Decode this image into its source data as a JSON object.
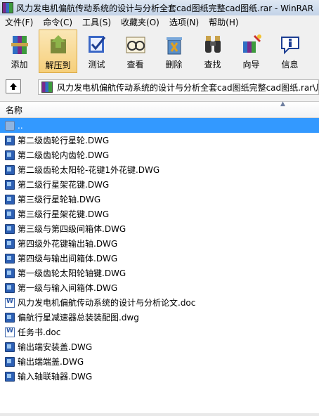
{
  "window": {
    "title": "风力发电机偏航传动系统的设计与分析全套cad图纸完整cad图纸.rar - WinRAR"
  },
  "menu": [
    "文件(F)",
    "命令(C)",
    "工具(S)",
    "收藏夹(O)",
    "选项(N)",
    "帮助(H)"
  ],
  "toolbar": [
    {
      "label": "添加",
      "icon": "add-icon"
    },
    {
      "label": "解压到",
      "icon": "extract-icon",
      "active": true
    },
    {
      "label": "测试",
      "icon": "test-icon"
    },
    {
      "label": "查看",
      "icon": "view-icon"
    },
    {
      "label": "删除",
      "icon": "delete-icon"
    },
    {
      "label": "查找",
      "icon": "find-icon"
    },
    {
      "label": "向导",
      "icon": "wizard-icon"
    },
    {
      "label": "信息",
      "icon": "info-icon"
    }
  ],
  "address": {
    "path": "风力发电机偏航传动系统的设计与分析全套cad图纸完整cad图纸.rar\\风"
  },
  "columns": {
    "name": "名称"
  },
  "files": [
    {
      "name": "..",
      "type": "up",
      "selected": true
    },
    {
      "name": "第二级齿轮行星轮.DWG",
      "type": "dwg"
    },
    {
      "name": "第二级齿轮内齿轮.DWG",
      "type": "dwg"
    },
    {
      "name": "第二级齿轮太阳轮-花键1外花键.DWG",
      "type": "dwg"
    },
    {
      "name": "第二级行星架花键.DWG",
      "type": "dwg"
    },
    {
      "name": "第三级行星轮轴.DWG",
      "type": "dwg"
    },
    {
      "name": "第三级行星架花键.DWG",
      "type": "dwg"
    },
    {
      "name": "第三级与第四级间箱体.DWG",
      "type": "dwg"
    },
    {
      "name": "第四级外花键输出轴.DWG",
      "type": "dwg"
    },
    {
      "name": "第四级与输出间箱体.DWG",
      "type": "dwg"
    },
    {
      "name": "第一级齿轮太阳轮轴键.DWG",
      "type": "dwg"
    },
    {
      "name": "第一级与输入间箱体.DWG",
      "type": "dwg"
    },
    {
      "name": "风力发电机偏航传动系统的设计与分析论文.doc",
      "type": "doc"
    },
    {
      "name": "偏航行星减速器总装装配图.dwg",
      "type": "dwg"
    },
    {
      "name": "任务书.doc",
      "type": "doc"
    },
    {
      "name": "输出端安装盖.DWG",
      "type": "dwg"
    },
    {
      "name": "输出端端盖.DWG",
      "type": "dwg"
    },
    {
      "name": "输入轴联轴器.DWG",
      "type": "dwg"
    }
  ]
}
